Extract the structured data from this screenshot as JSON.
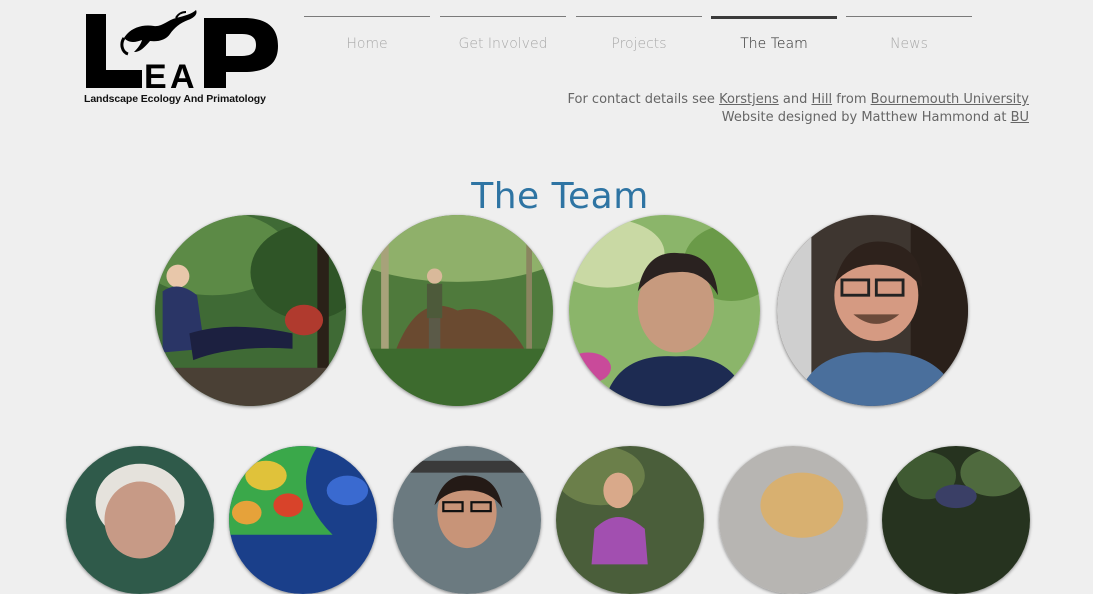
{
  "logo": {
    "mark_text": "LEAP",
    "caption": "Landscape Ecology And Primatology"
  },
  "nav": {
    "items": [
      {
        "label": "Home"
      },
      {
        "label": "Get Involved"
      },
      {
        "label": "Projects"
      },
      {
        "label": "The Team",
        "active": true
      },
      {
        "label": "News"
      }
    ]
  },
  "contact": {
    "line1_prefix": "For contact details see ",
    "link_korstjens": "Korstjens",
    "and": " and ",
    "link_hill": "Hill",
    "from": " from ",
    "link_university": "Bournemouth University",
    "line2_prefix": "Website designed by Matthew Hammond at ",
    "link_bu": "BU"
  },
  "page": {
    "title": "The Team"
  },
  "colors": {
    "background": "#efefef",
    "title": "#2e74a3",
    "nav_active": "#2a2a2a",
    "nav_inactive": "#a9a9a9"
  }
}
